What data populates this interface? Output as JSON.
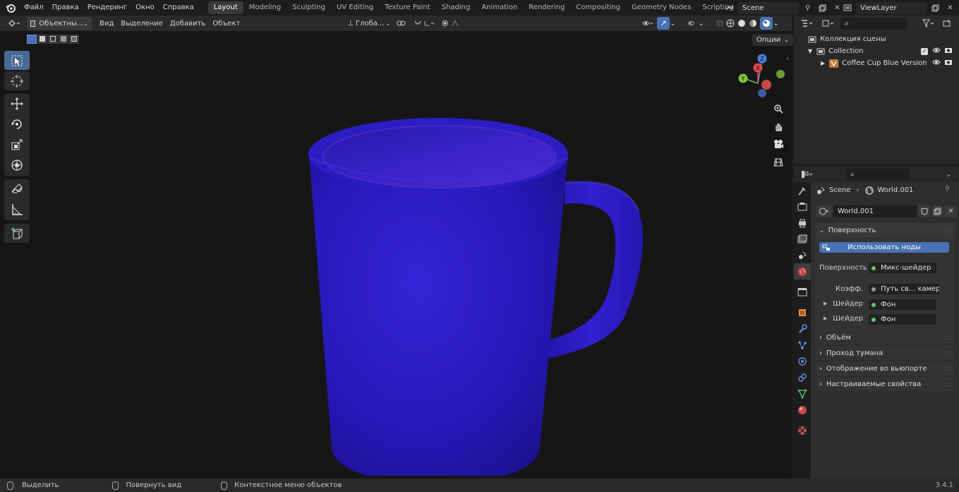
{
  "menu": [
    "Файл",
    "Правка",
    "Рендеринг",
    "Окно",
    "Справка"
  ],
  "workspaces": [
    "Layout",
    "Modeling",
    "Sculpting",
    "UV Editing",
    "Texture Paint",
    "Shading",
    "Animation",
    "Rendering",
    "Compositing",
    "Geometry Nodes",
    "Scripting"
  ],
  "active_workspace": "Layout",
  "scene_name": "Scene",
  "view_layer": "ViewLayer",
  "viewport_header": {
    "mode": "Объектны...",
    "view": "Вид",
    "select": "Выделение",
    "add": "Добавить",
    "object": "Объект",
    "transform": "Глоба...",
    "options": "Опции"
  },
  "outliner": {
    "scene_collection": "Коллекция сцены",
    "collection": "Collection",
    "object": "Coffee Cup Blue Version"
  },
  "properties": {
    "breadcrumb_scene": "Scene",
    "breadcrumb_world": "World.001",
    "world_name": "World.001",
    "surface_panel": "Поверхность",
    "use_nodes": "Использовать ноды",
    "surface_label": "Поверхность",
    "surface_value": "Микс-шейдер",
    "fac_label": "Коэфф.",
    "fac_value": "Путь св... камеры",
    "shader1_label": "Шейдер",
    "shader1_value": "Фон",
    "shader2_label": "Шейдер",
    "shader2_value": "Фон",
    "volume_panel": "Объём",
    "mist_panel": "Проход тумана",
    "viewport_display_panel": "Отображение во вьюпорте",
    "custom_props_panel": "Настраиваемые свойства"
  },
  "status": {
    "select": "Выделить",
    "rotate": "Повернуть вид",
    "context": "Контекстное меню объектов",
    "version": "3.4.1"
  },
  "colors": {
    "accent": "#4772b3",
    "mug": "#2a1fc4",
    "header": "#2a2a2a",
    "viewport": "#161616"
  },
  "gizmo_axes": [
    "Z",
    "X",
    "Y"
  ]
}
